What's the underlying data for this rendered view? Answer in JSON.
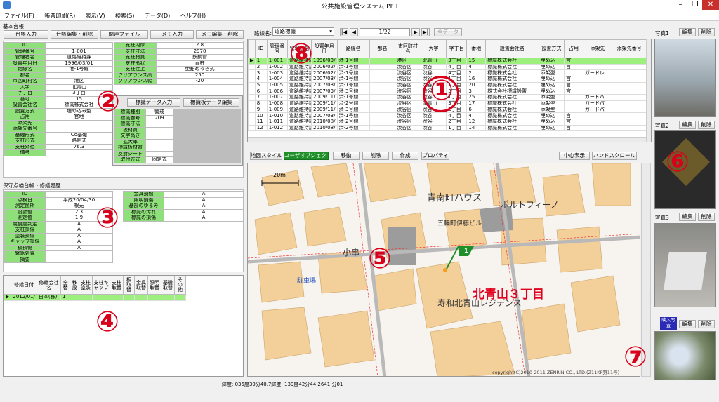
{
  "window": {
    "title": "公共施設管理システム PF I",
    "min": "–",
    "max": "❐",
    "close": "✕"
  },
  "menu": [
    "ファイル(F)",
    "帳票印刷(R)",
    "表示(V)",
    "検索(S)",
    "データ(D)",
    "ヘルプ(H)"
  ],
  "left": {
    "section_title": "基本台帳",
    "buttons": [
      "台帳入力",
      "台帳編集・削除",
      "関連ファイル",
      "メモ入力",
      "メモ編集・削除"
    ],
    "fields_left": [
      [
        "ID",
        "1"
      ],
      [
        "管理番号",
        "1-001"
      ],
      [
        "管理者名",
        "道路維持課"
      ],
      [
        "設置年月日",
        "1996/03/01"
      ],
      [
        "路線名",
        "港-1号線"
      ],
      [
        "都名",
        ""
      ],
      [
        "市区町村名",
        "港区"
      ],
      [
        "大字",
        "北青山"
      ],
      [
        "字丁目",
        "3丁目"
      ],
      [
        "番地",
        "15"
      ],
      [
        "設置会社名",
        "標識株式会社"
      ],
      [
        "設置方式",
        "埋め込み型"
      ],
      [
        "占用",
        "官地"
      ],
      [
        "添架先",
        ""
      ],
      [
        "添架先番号",
        ""
      ],
      [
        "基礎形式",
        "Co基礎"
      ],
      [
        "支柱形式",
        "路側式"
      ],
      [
        "支柱外径",
        "76.3"
      ],
      [
        "備考",
        ""
      ]
    ],
    "fields_right": [
      [
        "支柱内厚",
        "2.8"
      ],
      [
        "支柱寸法",
        "2970"
      ],
      [
        "支柱材質",
        "鉄鋼管"
      ],
      [
        "支柱形状",
        "直柱"
      ],
      [
        "支柱仕上",
        "亜鉛めっき式"
      ],
      [
        "クリアランス高",
        "250"
      ],
      [
        "クリアランス幅",
        "-20"
      ]
    ],
    "popup": {
      "btn1": "標識データ入力",
      "btn2": "標識板データ編集",
      "rows": [
        [
          "標識種別",
          "警戒"
        ],
        [
          "標識番号",
          "209"
        ],
        [
          "標識寸法",
          ""
        ],
        [
          "板材質",
          ""
        ],
        [
          "文字高さ",
          ""
        ],
        [
          "拡大率",
          ""
        ],
        [
          "標識板材質",
          ""
        ],
        [
          "反射シート",
          ""
        ],
        [
          "取付方式",
          "固定式"
        ]
      ]
    },
    "inspect_title": "保守点検台帳・修繕履歴",
    "inspect_left": [
      [
        "ID",
        "1"
      ],
      [
        "点検日",
        "平成20/04/30"
      ],
      [
        "測定箇所",
        "根元"
      ],
      [
        "設計値",
        "2.3"
      ],
      [
        "測定値",
        "1.9"
      ],
      [
        "腐食度判定",
        "A"
      ],
      [
        "支柱損傷",
        "A"
      ],
      [
        "塗装損傷",
        "A"
      ],
      [
        "キャップ損傷",
        "A"
      ],
      [
        "板損傷",
        "A"
      ],
      [
        "緊急処置",
        ""
      ],
      [
        "摘要",
        ""
      ]
    ],
    "inspect_right": [
      [
        "金具損傷",
        "A"
      ],
      [
        "照明損傷",
        "A"
      ],
      [
        "基部のゆるみ",
        "A"
      ],
      [
        "標識の汚れ",
        "A"
      ],
      [
        "標識の損傷",
        "A"
      ]
    ],
    "history_headers": [
      "修繕日付",
      "修繕会社名",
      "全替",
      "移設",
      "支柱塗装",
      "支柱キャップ",
      "支柱取替",
      "板取替",
      "金具取替",
      "照明取替",
      "基礎取替",
      "その他"
    ],
    "history_row": [
      "2012/01/",
      "日本(株)",
      "1",
      "",
      "",
      "",
      "",
      "",
      "",
      "",
      "",
      ""
    ]
  },
  "center": {
    "route_label": "路線名:",
    "route_value": "道路標識",
    "nav_first": "|◀",
    "nav_prev": "◀",
    "page": "1/22",
    "nav_next": "▶",
    "nav_last": "▶|",
    "all_data_btn": "全データ",
    "grid_headers": [
      "",
      "ID",
      "管理番号",
      "管理者名",
      "設置年月日",
      "路線名",
      "都名",
      "市区町村名",
      "大字",
      "字丁目",
      "番地",
      "設置会社名",
      "設置方式",
      "占用",
      "添架先",
      "添架先番号"
    ],
    "grid_rows": [
      [
        "▶",
        "1",
        "1-001",
        "道路維持課",
        "1996/03/",
        "港-1号線",
        "",
        "港区",
        "北青山",
        "3丁目",
        "15",
        "標識株式会社",
        "埋め込",
        "官",
        "",
        ""
      ],
      [
        "",
        "2",
        "1-002",
        "道路維持課",
        "2006/02/",
        "渋-1号線",
        "",
        "渋谷区",
        "渋谷",
        "4丁目",
        "4",
        "標識株式会社",
        "埋め込",
        "官",
        "",
        ""
      ],
      [
        "",
        "3",
        "1-003",
        "道路維持課",
        "2006/02/",
        "渋-1号線",
        "",
        "渋谷区",
        "渋谷",
        "4丁目",
        "2",
        "標識株式会社",
        "添架型",
        "",
        "ガードレ",
        ""
      ],
      [
        "",
        "4",
        "1-004",
        "道路維持課",
        "2007/03/",
        "渋-1号線",
        "",
        "渋谷区",
        "渋谷",
        "1丁目",
        "16",
        "標識株式会社",
        "埋め込",
        "官",
        "",
        ""
      ],
      [
        "",
        "5",
        "1-005",
        "道路維持課",
        "2007/03/",
        "渋-1号線",
        "",
        "渋谷区",
        "渋谷",
        "1丁目",
        "20",
        "標識株式会社",
        "埋め込",
        "官",
        "",
        ""
      ],
      [
        "",
        "6",
        "1-006",
        "道路維持課",
        "2007/03/",
        "渋-3号線",
        "",
        "渋谷区",
        "渋谷",
        "3丁目",
        "3",
        "株式会社標識設置",
        "埋め込",
        "官",
        "",
        ""
      ],
      [
        "",
        "7",
        "1-007",
        "道路維持課",
        "2009/11/",
        "渋-1号線",
        "",
        "渋谷区",
        "渋谷",
        "1丁目",
        "25",
        "標識株式会社",
        "添架型",
        "",
        "ガードパ",
        ""
      ],
      [
        "",
        "8",
        "1-008",
        "道路維持課",
        "2009/11/",
        "渋-2号線",
        "",
        "渋谷区",
        "南青山",
        "3丁目",
        "17",
        "標識株式会社",
        "添架型",
        "",
        "ガードパ",
        ""
      ],
      [
        "",
        "9",
        "1-009",
        "道路維持課",
        "2009/11/",
        "渋-3号線",
        "",
        "渋谷区",
        "渋谷",
        "2丁目",
        "6",
        "標識株式会社",
        "添架型",
        "",
        "ガードパ",
        ""
      ],
      [
        "",
        "10",
        "1-010",
        "道路維持課",
        "2007/03/",
        "渋-1号線",
        "",
        "渋谷区",
        "渋谷",
        "4丁目",
        "4",
        "標識株式会社",
        "埋め込",
        "官",
        "",
        ""
      ],
      [
        "",
        "11",
        "1-011",
        "道路維持課",
        "2010/08/",
        "渋-2号線",
        "",
        "渋谷区",
        "渋谷",
        "2丁目",
        "12",
        "標識株式会社",
        "埋め込",
        "官",
        "",
        ""
      ],
      [
        "",
        "12",
        "1-012",
        "道路維持課",
        "2010/08/",
        "渋-2号線",
        "",
        "渋谷区",
        "渋谷",
        "1丁目",
        "14",
        "標識株式会社",
        "埋め込",
        "官",
        "",
        ""
      ]
    ],
    "map_buttons": [
      "地図スタイル",
      "ユーザオブジェクト",
      "移動",
      "削除",
      "作成",
      "プロパティ"
    ],
    "map_right_buttons": [
      "中心表示",
      "ハンドスクロール"
    ],
    "scale": "20m",
    "area_label": "北青山３丁目",
    "labels": [
      "青南町ハウス",
      "五輪町伊藤ビル",
      "小串",
      "寿和北青山レジデンス",
      "ポルトフィーノ",
      "駐車場"
    ],
    "marker_id": "1",
    "copyright": "copyright(C)2010-2011 ZENRIN CO., LTD.(Z11KF第11号)"
  },
  "right": {
    "photos": [
      {
        "label": "写真1",
        "edit": "編集",
        "del": "削除"
      },
      {
        "label": "写真2",
        "edit": "編集",
        "del": "削除"
      },
      {
        "label": "写真3",
        "edit": "編集",
        "del": "削除"
      },
      {
        "label": "映入写真",
        "edit": "編集",
        "del": "削除"
      }
    ]
  },
  "status": "緯度: 035度39分40.7緯度: 139度42分44.2641 分01",
  "badges": [
    "①",
    "②",
    "③",
    "④",
    "⑤",
    "⑥",
    "⑦",
    "⑧"
  ],
  "colors": {
    "accent_green": "#8fe07a",
    "row_select": "#9ef07e",
    "badge_red": "#d8001a"
  }
}
